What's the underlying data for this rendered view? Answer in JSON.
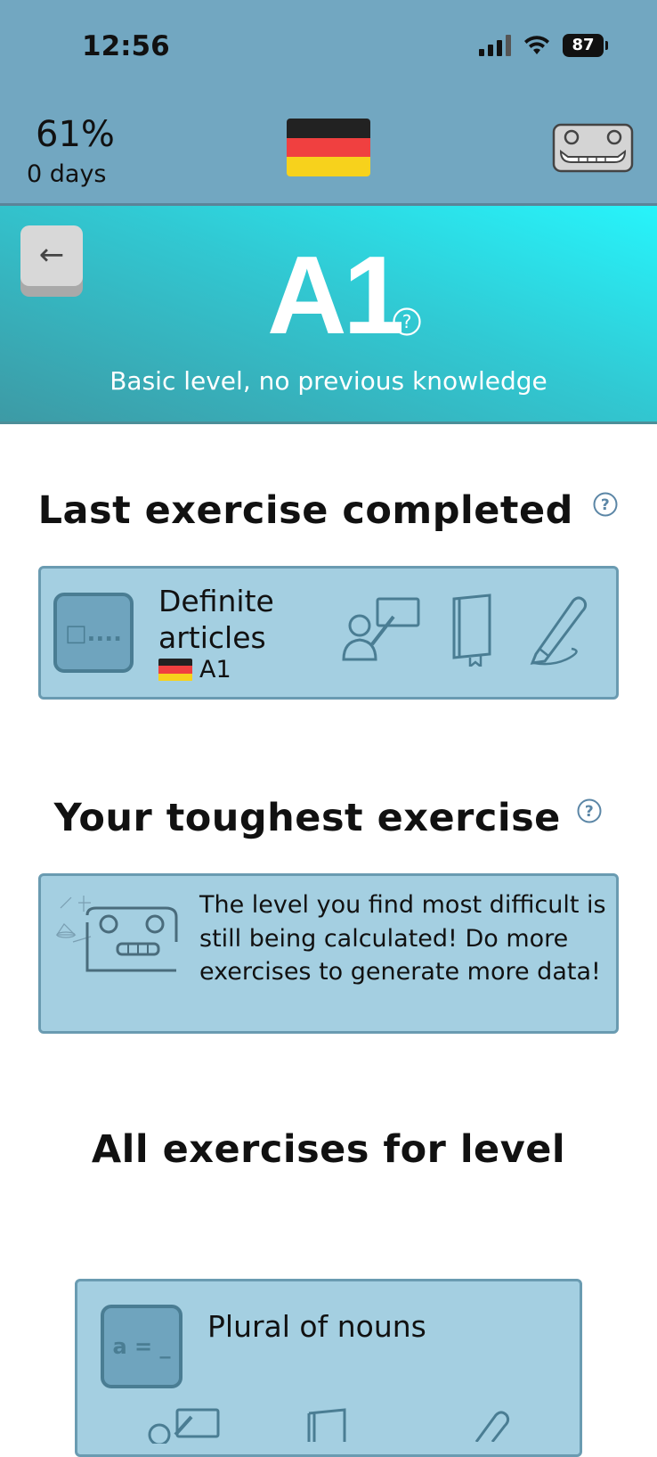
{
  "status_bar": {
    "time": "12:56",
    "battery": "87"
  },
  "header": {
    "progress_percent": "61%",
    "streak": "0 days",
    "language_flag": "germany-flag"
  },
  "level": {
    "back_symbol": "←",
    "name": "A1",
    "description": "Basic level, no previous knowledge"
  },
  "last_exercise": {
    "heading": "Last exercise completed",
    "card": {
      "icon_text": "□....",
      "title_line1": "Definite",
      "title_line2": "articles",
      "level": "A1"
    }
  },
  "toughest": {
    "heading": "Your toughest exercise",
    "message": "The level you find most difficult is still being calculated! Do more exercises to generate more data!"
  },
  "all_exercises": {
    "heading": "All exercises for level",
    "items": [
      {
        "icon_text": "a = _",
        "title": "Plural of nouns"
      }
    ]
  },
  "colors": {
    "header_bg": "#72a7c1",
    "banner_top": "#27f4fb",
    "banner_bottom": "#3d9aa5",
    "card_bg": "#a4cfe1",
    "card_border": "#6a9bb1",
    "icon_stroke": "#4a7d93"
  }
}
